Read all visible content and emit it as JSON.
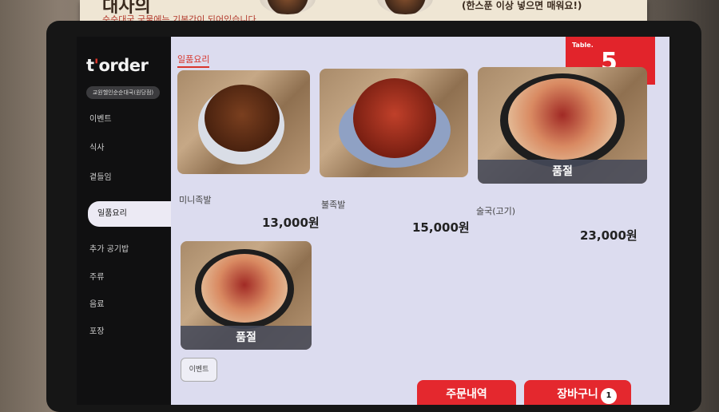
{
  "sign": {
    "title": "대사의",
    "left_note": "순순대국 국물에는 기본간이 되어있습니다.",
    "right_note": "(한스푼 이상 넣으면 매워요!)"
  },
  "sidebar": {
    "logo_main": "t",
    "logo_apos": "'",
    "logo_rest": "order",
    "store_name": "교원헬인순순대국(원당점)",
    "items": [
      {
        "label": "이벤트"
      },
      {
        "label": "식사"
      },
      {
        "label": "곁들임"
      },
      {
        "label": "일품요리"
      },
      {
        "label": "추가 공기밥"
      },
      {
        "label": "주류"
      },
      {
        "label": "음료"
      },
      {
        "label": "포장"
      }
    ],
    "active_index": 3
  },
  "main": {
    "category_title": "일품요리",
    "table_label": "Table.",
    "table_number": "5",
    "menu": [
      {
        "name": "미니족발",
        "price": "13,000원",
        "soldout": false
      },
      {
        "name": "불족발",
        "price": "15,000원",
        "soldout": false
      },
      {
        "name": "술국(고기)",
        "price": "23,000원",
        "soldout": true,
        "soldout_label": "품절"
      },
      {
        "name": "",
        "price": "",
        "soldout": true,
        "soldout_label": "품절"
      }
    ],
    "event_button": "이벤트",
    "order_history_button": "주문내역",
    "cart_button": "장바구니",
    "cart_count": "1"
  },
  "colors": {
    "accent": "#e2242b",
    "sidebar_bg": "#101011",
    "screen_bg": "#dcdcef"
  }
}
